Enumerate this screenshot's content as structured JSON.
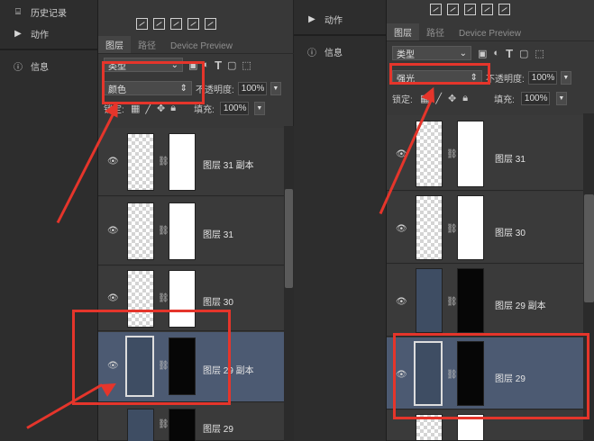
{
  "left_panel": {
    "sidebar": [
      {
        "label": "历史记录",
        "icon": "history-icon"
      },
      {
        "label": "动作",
        "icon": "play-icon"
      },
      {
        "label": "信息",
        "icon": "info-icon"
      }
    ],
    "tabs": [
      {
        "label": "图层"
      },
      {
        "label": "路径"
      },
      {
        "label": "Device Preview"
      }
    ],
    "kind_label": "类型",
    "blend_mode": "颜色",
    "opacity_label": "不透明度:",
    "opacity_value": "100%",
    "lock_label": "锁定:",
    "fill_label": "填充:",
    "fill_value": "100%",
    "layers": [
      {
        "name": "图层 31 副本",
        "selected": false
      },
      {
        "name": "图层 31",
        "selected": false
      },
      {
        "name": "图层 30",
        "selected": false
      },
      {
        "name": "图层 29 副本",
        "selected": true
      },
      {
        "name": "图层 29",
        "selected": false
      }
    ]
  },
  "right_panel": {
    "sidebar": [
      {
        "label": "动作",
        "icon": "play-icon"
      },
      {
        "label": "信息",
        "icon": "info-icon"
      }
    ],
    "tabs": [
      {
        "label": "图层"
      },
      {
        "label": "路径"
      },
      {
        "label": "Device Preview"
      }
    ],
    "kind_label": "类型",
    "blend_mode": "强光",
    "opacity_label": "不透明度:",
    "opacity_value": "100%",
    "lock_label": "锁定:",
    "fill_label": "填充:",
    "fill_value": "100%",
    "layers": [
      {
        "name": "图层 31",
        "selected": false
      },
      {
        "name": "图层 30",
        "selected": false
      },
      {
        "name": "图层 29 副本",
        "selected": false
      },
      {
        "name": "图层 29",
        "selected": true
      }
    ]
  },
  "colors": {
    "annotation": "#e5352b",
    "selected_layer": "#4c5a72",
    "panel": "#383838"
  }
}
